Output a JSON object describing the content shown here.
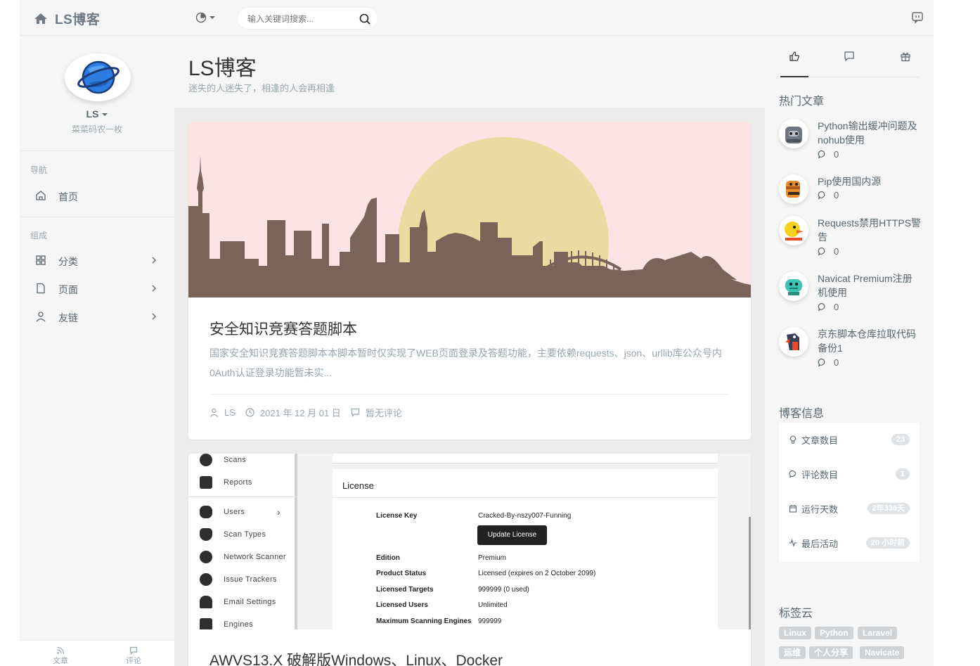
{
  "header": {
    "brand": "LS博客",
    "search_placeholder": "输入关键词搜索..."
  },
  "sidebar": {
    "user_name": "LS",
    "user_desc": "菜菜码农一枚",
    "nav_heading": "导航",
    "nav_items": [
      {
        "label": "首页",
        "icon": "home-icon"
      }
    ],
    "group_heading": "组成",
    "group_items": [
      {
        "label": "分类",
        "icon": "grid-icon"
      },
      {
        "label": "页面",
        "icon": "file-icon"
      },
      {
        "label": "友链",
        "icon": "user-icon"
      }
    ],
    "footer": [
      {
        "label": "文章",
        "icon": "rss-icon"
      },
      {
        "label": "评论",
        "icon": "comment-icon"
      }
    ]
  },
  "main": {
    "site_title": "LS博客",
    "site_subtitle": "迷失的人迷失了，相逢的人会再相逢",
    "posts": [
      {
        "title": "安全知识竞赛答题脚本",
        "summary": "国家安全知识竞赛答题脚本本脚本暂时仅实现了WEB页面登录及答题功能，主要依赖requests、json、urllib库公众号内0Auth认证登录功能暂未实...",
        "author": "LS",
        "date": "2021 年 12 月 01 日",
        "comments": "暂无评论"
      },
      {
        "title": "AWVS13.X 破解版Windows、Linux、Docker",
        "cover": {
          "nav": [
            "Scans",
            "Reports",
            "Users",
            "Scan Types",
            "Network Scanner",
            "Issue Trackers",
            "Email Settings",
            "Engines"
          ],
          "panel_title": "License",
          "update_button": "Update License",
          "rows": [
            {
              "k": "License Key",
              "v": "Cracked-By-nszy007-Funning"
            },
            {
              "k": "Edition",
              "v": "Premium"
            },
            {
              "k": "Product Status",
              "v": "Licensed (expires on 2 October 2099)"
            },
            {
              "k": "Licensed Targets",
              "v": "999999 (0 used)"
            },
            {
              "k": "Licensed Users",
              "v": "Unlimited"
            },
            {
              "k": "Maximum Scanning Engines",
              "v": "999999"
            }
          ]
        }
      }
    ]
  },
  "aside": {
    "hot_title": "热门文章",
    "hot_posts": [
      {
        "title": "Python输出缓冲问题及nohub使用",
        "comments": "0"
      },
      {
        "title": "Pip使用国内源",
        "comments": "0"
      },
      {
        "title": "Requests禁用HTTPS警告",
        "comments": "0"
      },
      {
        "title": "Navicat Premium注册机使用",
        "comments": "0"
      },
      {
        "title": "京东脚本仓库拉取代码备份1",
        "comments": "0"
      }
    ],
    "info_title": "博客信息",
    "info": [
      {
        "label": "文章数目",
        "value": "23"
      },
      {
        "label": "评论数目",
        "value": "1"
      },
      {
        "label": "运行天数",
        "value": "2年336天"
      },
      {
        "label": "最后活动",
        "value": "20 小时前"
      }
    ],
    "tags_title": "标签云",
    "tags": [
      "Linux",
      "Python",
      "Laravel",
      "运维",
      "个人分享",
      "Navicate"
    ]
  },
  "colors": {
    "cover_sky": "#fde4e4",
    "cover_sun": "#e8dca3",
    "cover_city": "#7a6359",
    "planet_blue": "#2b7de0"
  }
}
